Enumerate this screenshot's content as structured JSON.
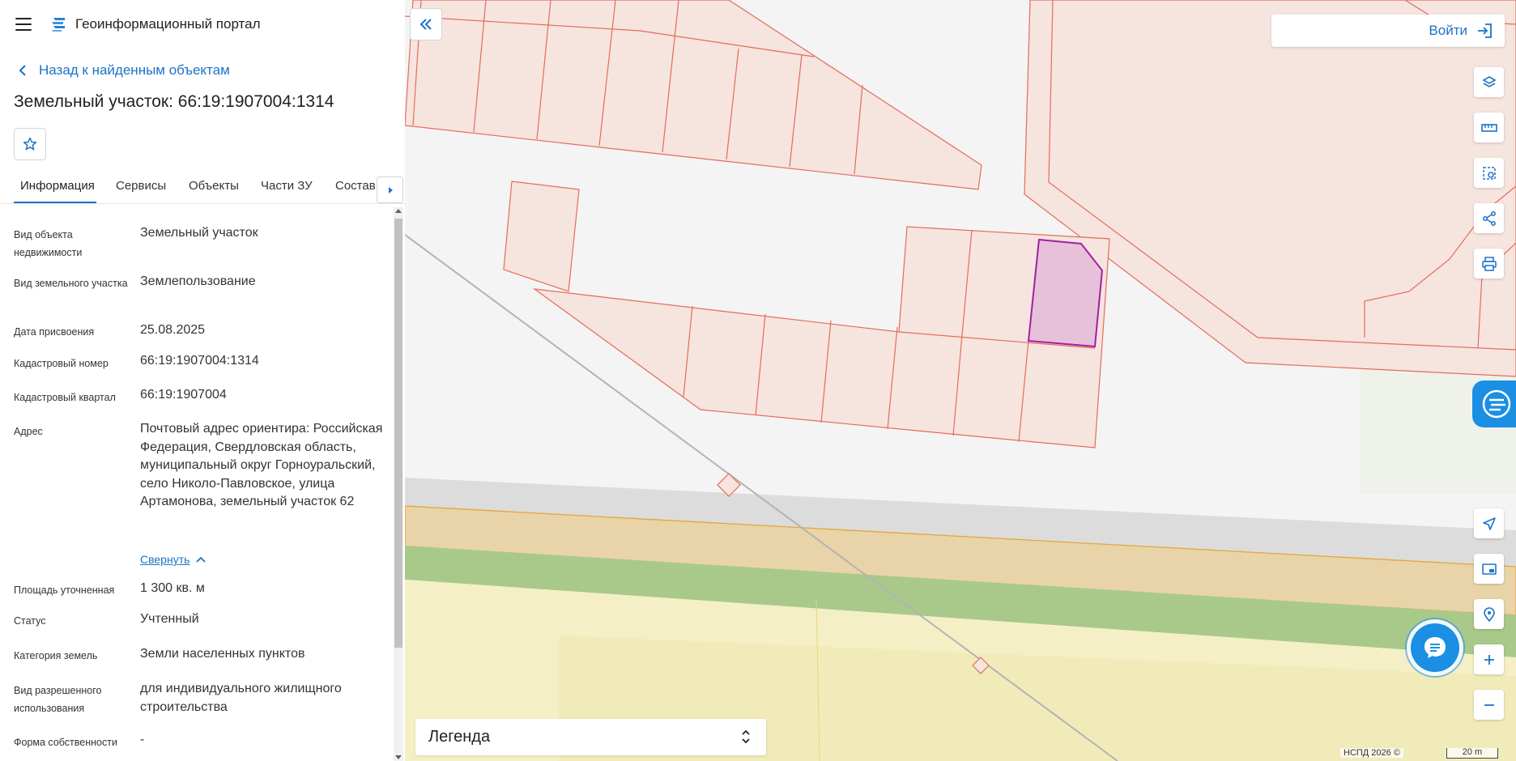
{
  "header": {
    "app_title": "Геоинформационный портал"
  },
  "nav": {
    "back_label": "Назад к найденным объектам"
  },
  "object": {
    "title": "Земельный участок: 66:19:1907004:1314"
  },
  "tabs": [
    {
      "label": "Информация",
      "active": true
    },
    {
      "label": "Сервисы"
    },
    {
      "label": "Объекты"
    },
    {
      "label": "Части ЗУ"
    },
    {
      "label": "Состав"
    }
  ],
  "properties": [
    {
      "label": "Вид объекта недвижимости",
      "value": "Земельный участок"
    },
    {
      "label": "Вид земельного участка",
      "value": "Землепользование"
    },
    {
      "label": "Дата присвоения",
      "value": "25.08.2025"
    },
    {
      "label": "Кадастровый номер",
      "value": "66:19:1907004:1314"
    },
    {
      "label": "Кадастровый квартал",
      "value": "66:19:1907004"
    },
    {
      "label": "Адрес",
      "value": "Почтовый адрес ориентира: Российская Федерация, Свердловская область, муниципальный округ Горноуральский, село Николо-Павловское, улица Артамонова, земельный участок 62"
    },
    {
      "label": "Площадь уточненная",
      "value": "1 300 кв. м"
    },
    {
      "label": "Статус",
      "value": "Учтенный"
    },
    {
      "label": "Категория земель",
      "value": "Земли населенных пунктов"
    },
    {
      "label": "Вид разрешенного использования",
      "value": "для индивидуального жилищного строительства"
    },
    {
      "label": "Форма собственности",
      "value": "-"
    }
  ],
  "address_toggle": {
    "label": "Свернуть"
  },
  "map": {
    "login_label": "Войти",
    "legend_label": "Легенда",
    "attribution": "НСПД 2026 ©",
    "scale_label": "20 m",
    "colors": {
      "parcel_fill": "#f6e4df",
      "parcel_stroke": "#e46c5a",
      "selected_fill": "#e6c1d9",
      "selected_stroke": "#a31fa6",
      "water": "#c5d3ea",
      "accent": "#1a73c9"
    }
  },
  "toolbar_icons": [
    "layers-icon",
    "ruler-icon",
    "area-select-icon",
    "share-icon",
    "print-icon",
    "assistant-icon",
    "navigate-icon",
    "minimap-icon",
    "location-icon",
    "zoom-in-icon",
    "zoom-out-icon"
  ]
}
